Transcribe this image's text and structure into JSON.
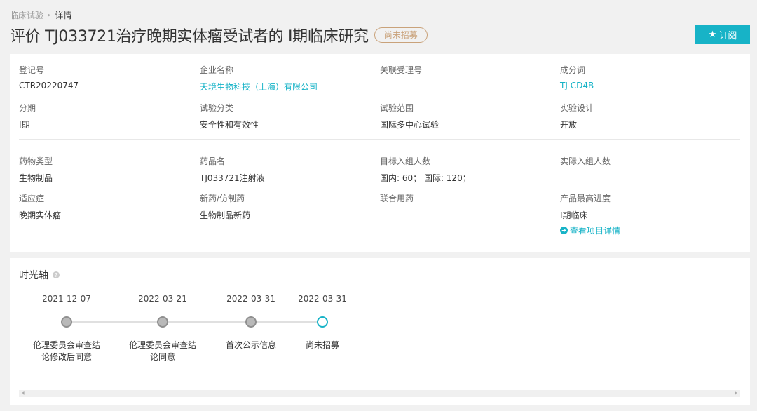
{
  "breadcrumb": {
    "parent": "临床试验",
    "separator": "▸",
    "current": "详情"
  },
  "page_title": "评价 TJ033721治疗晚期实体瘤受试者的 Ⅰ期临床研究",
  "status_badge": "尚未招募",
  "subscribe": {
    "icon": "star-icon",
    "star": "★",
    "label": "订阅"
  },
  "info": {
    "reg_no": {
      "label": "登记号",
      "value": "CTR20220747"
    },
    "company": {
      "label": "企业名称",
      "value": "天境生物科技（上海）有限公司"
    },
    "acceptance_no": {
      "label": "关联受理号",
      "value": ""
    },
    "ingredient": {
      "label": "成分词",
      "value": "TJ-CD4B"
    },
    "phase": {
      "label": "分期",
      "value": "Ⅰ期"
    },
    "trial_category": {
      "label": "试验分类",
      "value": "安全性和有效性"
    },
    "trial_scope": {
      "label": "试验范围",
      "value": "国际多中心试验"
    },
    "design": {
      "label": "实验设计",
      "value": "开放"
    },
    "drug_type": {
      "label": "药物类型",
      "value": "生物制品"
    },
    "drug_name": {
      "label": "药品名",
      "value": "TJ033721注射液"
    },
    "target_enroll": {
      "label": "目标入组人数",
      "value": "国内: 60；  国际: 120；"
    },
    "actual_enroll": {
      "label": "实际入组人数",
      "value": ""
    },
    "indication": {
      "label": "适应症",
      "value": "晚期实体瘤"
    },
    "new_generic": {
      "label": "新药/仿制药",
      "value": "生物制品新药"
    },
    "combination": {
      "label": "联合用药",
      "value": ""
    },
    "max_progress": {
      "label": "产品最高进度",
      "value": "Ⅰ期临床",
      "link": "查看项目详情",
      "icon": "arrow-circle-icon"
    }
  },
  "timeline": {
    "title": "时光轴",
    "help_icon": "help-icon",
    "events": [
      {
        "date": "2021-12-07",
        "label": "伦理委员会审查结论修改后同意",
        "current": false
      },
      {
        "date": "2022-03-21",
        "label": "伦理委员会审查结论同意",
        "current": false
      },
      {
        "date": "2022-03-31",
        "label": "首次公示信息",
        "current": false
      },
      {
        "date": "2022-03-31",
        "label": "尚未招募",
        "current": true
      }
    ]
  },
  "colors": {
    "accent": "#17b3c7",
    "badge": "#c9a27a",
    "node": "#b9b9b9"
  }
}
